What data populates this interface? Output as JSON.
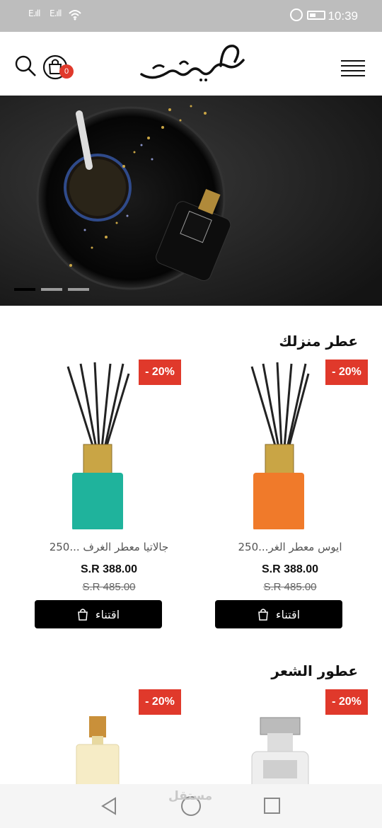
{
  "status_bar": {
    "time": "10:39",
    "signal": "E.ıll E.ıll"
  },
  "header": {
    "cart_count": "0",
    "logo_icon": "arabic-calligraphy-logo"
  },
  "hero": {
    "slides": 3,
    "active_slide": 1
  },
  "sections": [
    {
      "title": "عطر منزلك",
      "products": [
        {
          "name": "ايوس معطر الغر...250",
          "price": "S.R 388.00",
          "old_price": "S.R 485.00",
          "discount": "- 20%",
          "buy_label": "اقتناء",
          "color": "#f07a2a"
        },
        {
          "name": "جالاتيا معطر الغرف ...250",
          "price": "S.R 388.00",
          "old_price": "S.R 485.00",
          "discount": "- 20%",
          "buy_label": "اقتناء",
          "color": "#1fb39c"
        }
      ]
    },
    {
      "title": "عطور الشعر",
      "products": [
        {
          "discount": "- 20%"
        },
        {
          "discount": "- 20%"
        }
      ]
    }
  ],
  "watermark": "مستقل",
  "colors": {
    "accent": "#e0392b",
    "button": "#000000"
  }
}
